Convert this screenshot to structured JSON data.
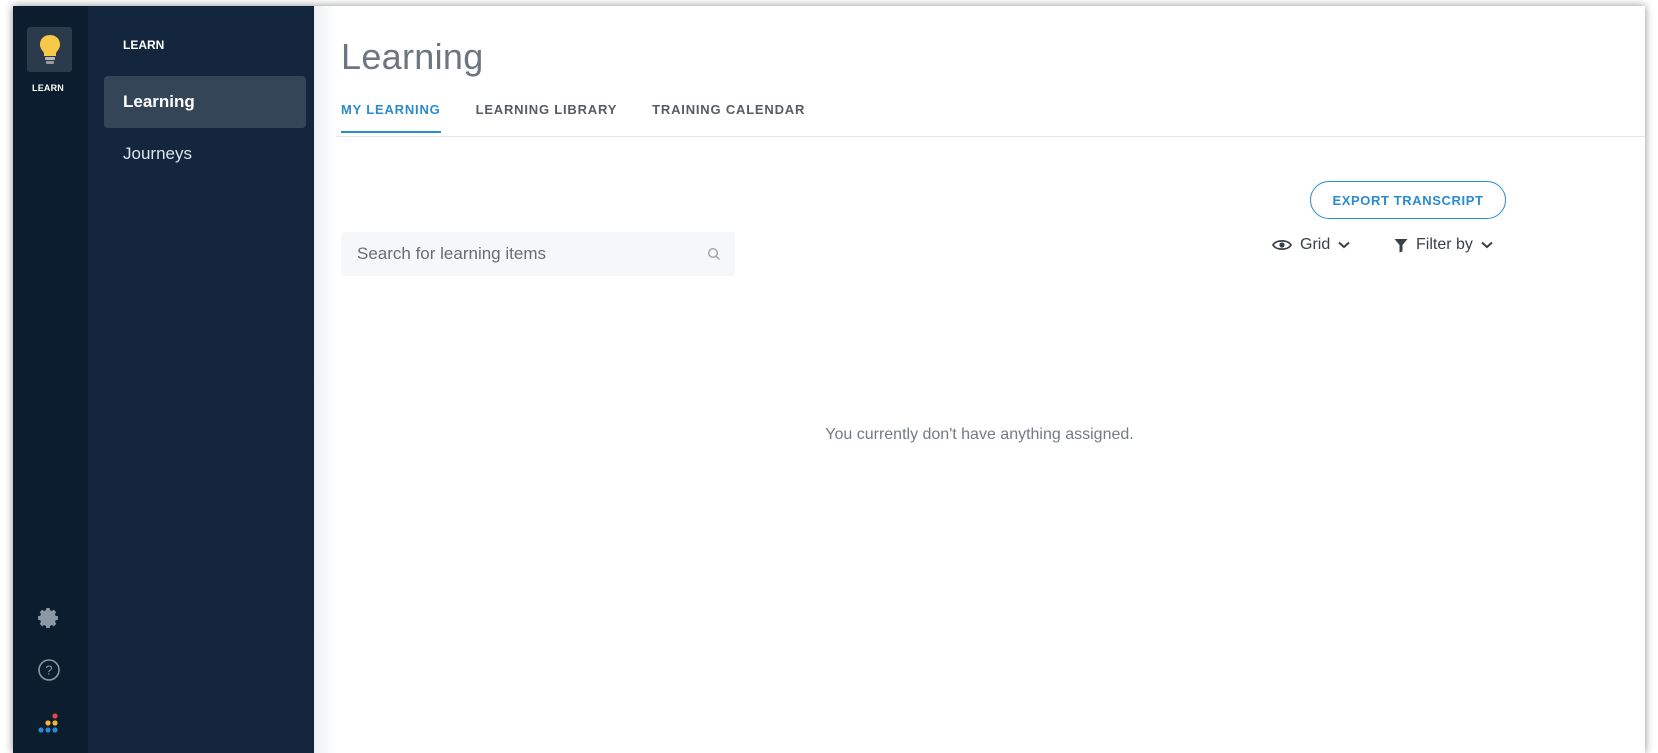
{
  "rail": {
    "app_label": "LEARN",
    "colors": {
      "bulb": "#f7c948",
      "rail_bg": "#0b1d2e"
    }
  },
  "subnav": {
    "heading": "LEARN",
    "items": [
      {
        "label": "Learning",
        "active": true
      },
      {
        "label": "Journeys",
        "active": false
      }
    ]
  },
  "main": {
    "title": "Learning",
    "tabs": [
      {
        "label": "MY LEARNING",
        "active": true
      },
      {
        "label": "LEARNING LIBRARY",
        "active": false
      },
      {
        "label": "TRAINING CALENDAR",
        "active": false
      }
    ],
    "export_button": "EXPORT TRANSCRIPT",
    "search": {
      "placeholder": "Search for learning items",
      "value": ""
    },
    "view_toggle": "Grid",
    "filter_toggle": "Filter by",
    "empty_message": "You currently don't have anything assigned.",
    "accent_color": "#2b8bd0"
  }
}
